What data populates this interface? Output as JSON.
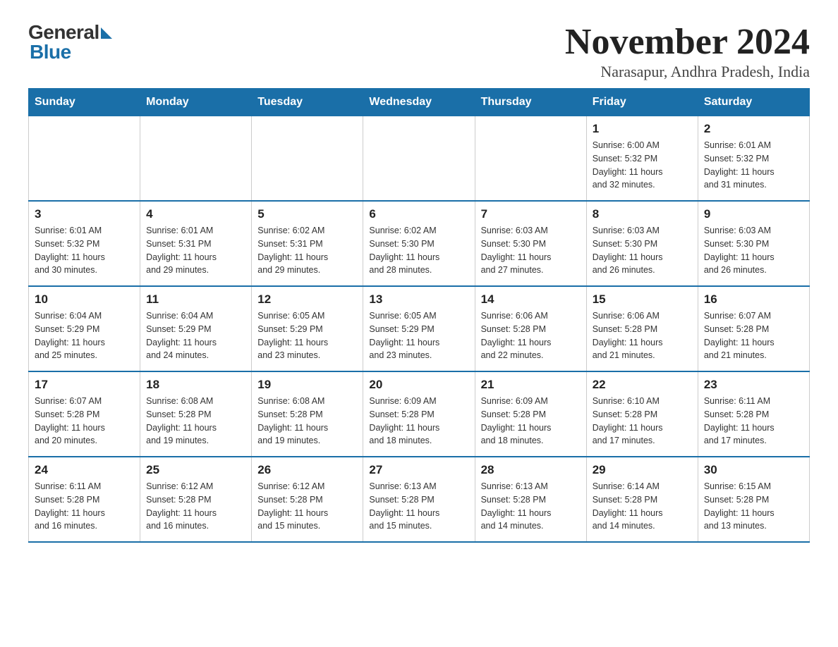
{
  "header": {
    "month_year": "November 2024",
    "location": "Narasapur, Andhra Pradesh, India",
    "logo_general": "General",
    "logo_blue": "Blue"
  },
  "weekdays": [
    "Sunday",
    "Monday",
    "Tuesday",
    "Wednesday",
    "Thursday",
    "Friday",
    "Saturday"
  ],
  "weeks": [
    [
      {
        "day": "",
        "info": ""
      },
      {
        "day": "",
        "info": ""
      },
      {
        "day": "",
        "info": ""
      },
      {
        "day": "",
        "info": ""
      },
      {
        "day": "",
        "info": ""
      },
      {
        "day": "1",
        "info": "Sunrise: 6:00 AM\nSunset: 5:32 PM\nDaylight: 11 hours\nand 32 minutes."
      },
      {
        "day": "2",
        "info": "Sunrise: 6:01 AM\nSunset: 5:32 PM\nDaylight: 11 hours\nand 31 minutes."
      }
    ],
    [
      {
        "day": "3",
        "info": "Sunrise: 6:01 AM\nSunset: 5:32 PM\nDaylight: 11 hours\nand 30 minutes."
      },
      {
        "day": "4",
        "info": "Sunrise: 6:01 AM\nSunset: 5:31 PM\nDaylight: 11 hours\nand 29 minutes."
      },
      {
        "day": "5",
        "info": "Sunrise: 6:02 AM\nSunset: 5:31 PM\nDaylight: 11 hours\nand 29 minutes."
      },
      {
        "day": "6",
        "info": "Sunrise: 6:02 AM\nSunset: 5:30 PM\nDaylight: 11 hours\nand 28 minutes."
      },
      {
        "day": "7",
        "info": "Sunrise: 6:03 AM\nSunset: 5:30 PM\nDaylight: 11 hours\nand 27 minutes."
      },
      {
        "day": "8",
        "info": "Sunrise: 6:03 AM\nSunset: 5:30 PM\nDaylight: 11 hours\nand 26 minutes."
      },
      {
        "day": "9",
        "info": "Sunrise: 6:03 AM\nSunset: 5:30 PM\nDaylight: 11 hours\nand 26 minutes."
      }
    ],
    [
      {
        "day": "10",
        "info": "Sunrise: 6:04 AM\nSunset: 5:29 PM\nDaylight: 11 hours\nand 25 minutes."
      },
      {
        "day": "11",
        "info": "Sunrise: 6:04 AM\nSunset: 5:29 PM\nDaylight: 11 hours\nand 24 minutes."
      },
      {
        "day": "12",
        "info": "Sunrise: 6:05 AM\nSunset: 5:29 PM\nDaylight: 11 hours\nand 23 minutes."
      },
      {
        "day": "13",
        "info": "Sunrise: 6:05 AM\nSunset: 5:29 PM\nDaylight: 11 hours\nand 23 minutes."
      },
      {
        "day": "14",
        "info": "Sunrise: 6:06 AM\nSunset: 5:28 PM\nDaylight: 11 hours\nand 22 minutes."
      },
      {
        "day": "15",
        "info": "Sunrise: 6:06 AM\nSunset: 5:28 PM\nDaylight: 11 hours\nand 21 minutes."
      },
      {
        "day": "16",
        "info": "Sunrise: 6:07 AM\nSunset: 5:28 PM\nDaylight: 11 hours\nand 21 minutes."
      }
    ],
    [
      {
        "day": "17",
        "info": "Sunrise: 6:07 AM\nSunset: 5:28 PM\nDaylight: 11 hours\nand 20 minutes."
      },
      {
        "day": "18",
        "info": "Sunrise: 6:08 AM\nSunset: 5:28 PM\nDaylight: 11 hours\nand 19 minutes."
      },
      {
        "day": "19",
        "info": "Sunrise: 6:08 AM\nSunset: 5:28 PM\nDaylight: 11 hours\nand 19 minutes."
      },
      {
        "day": "20",
        "info": "Sunrise: 6:09 AM\nSunset: 5:28 PM\nDaylight: 11 hours\nand 18 minutes."
      },
      {
        "day": "21",
        "info": "Sunrise: 6:09 AM\nSunset: 5:28 PM\nDaylight: 11 hours\nand 18 minutes."
      },
      {
        "day": "22",
        "info": "Sunrise: 6:10 AM\nSunset: 5:28 PM\nDaylight: 11 hours\nand 17 minutes."
      },
      {
        "day": "23",
        "info": "Sunrise: 6:11 AM\nSunset: 5:28 PM\nDaylight: 11 hours\nand 17 minutes."
      }
    ],
    [
      {
        "day": "24",
        "info": "Sunrise: 6:11 AM\nSunset: 5:28 PM\nDaylight: 11 hours\nand 16 minutes."
      },
      {
        "day": "25",
        "info": "Sunrise: 6:12 AM\nSunset: 5:28 PM\nDaylight: 11 hours\nand 16 minutes."
      },
      {
        "day": "26",
        "info": "Sunrise: 6:12 AM\nSunset: 5:28 PM\nDaylight: 11 hours\nand 15 minutes."
      },
      {
        "day": "27",
        "info": "Sunrise: 6:13 AM\nSunset: 5:28 PM\nDaylight: 11 hours\nand 15 minutes."
      },
      {
        "day": "28",
        "info": "Sunrise: 6:13 AM\nSunset: 5:28 PM\nDaylight: 11 hours\nand 14 minutes."
      },
      {
        "day": "29",
        "info": "Sunrise: 6:14 AM\nSunset: 5:28 PM\nDaylight: 11 hours\nand 14 minutes."
      },
      {
        "day": "30",
        "info": "Sunrise: 6:15 AM\nSunset: 5:28 PM\nDaylight: 11 hours\nand 13 minutes."
      }
    ]
  ]
}
